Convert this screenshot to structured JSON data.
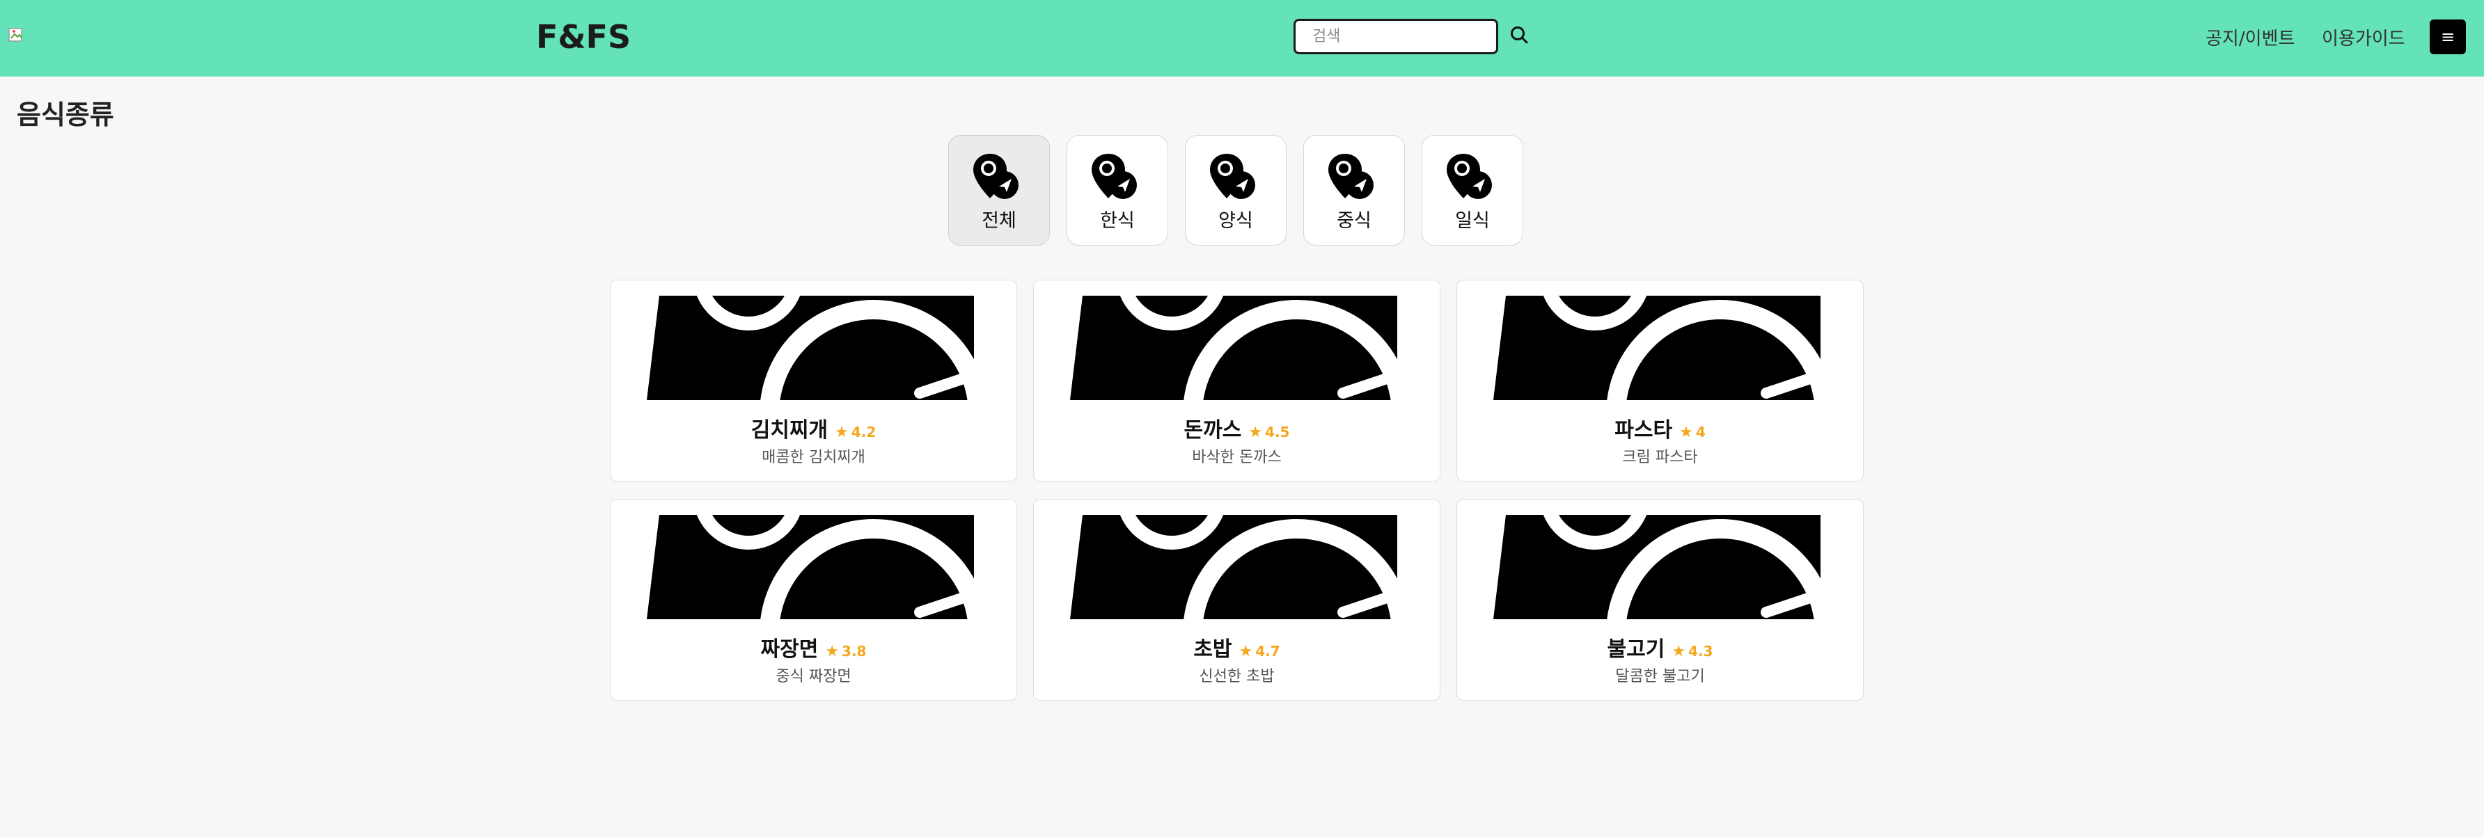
{
  "header": {
    "brand": "F&FS",
    "search_placeholder": "검색",
    "nav": [
      "공지/이벤트",
      "이용가이드"
    ],
    "menu_icon": "≡",
    "background_color": "#63e3b7"
  },
  "section": {
    "title": "음식종류"
  },
  "categories": [
    {
      "label": "전체",
      "active": true,
      "icon": "location-pin-icon"
    },
    {
      "label": "한식",
      "active": false,
      "icon": "location-pin-icon"
    },
    {
      "label": "양식",
      "active": false,
      "icon": "location-pin-icon"
    },
    {
      "label": "중식",
      "active": false,
      "icon": "location-pin-icon"
    },
    {
      "label": "일식",
      "active": false,
      "icon": "location-pin-icon"
    }
  ],
  "foods": [
    {
      "name": "김치찌개",
      "rating": "4.2",
      "desc": "매콤한 김치찌개",
      "star": "★"
    },
    {
      "name": "돈까스",
      "rating": "4.5",
      "desc": "바삭한 돈까스",
      "star": "★"
    },
    {
      "name": "파스타",
      "rating": "4",
      "desc": "크림 파스타",
      "star": "★"
    },
    {
      "name": "짜장면",
      "rating": "3.8",
      "desc": "중식 짜장면",
      "star": "★"
    },
    {
      "name": "초밥",
      "rating": "4.7",
      "desc": "신선한 초밥",
      "star": "★"
    },
    {
      "name": "불고기",
      "rating": "4.3",
      "desc": "달콤한 불고기",
      "star": "★"
    }
  ],
  "colors": {
    "accent": "#63e3b7",
    "star": "#f3a81e"
  }
}
